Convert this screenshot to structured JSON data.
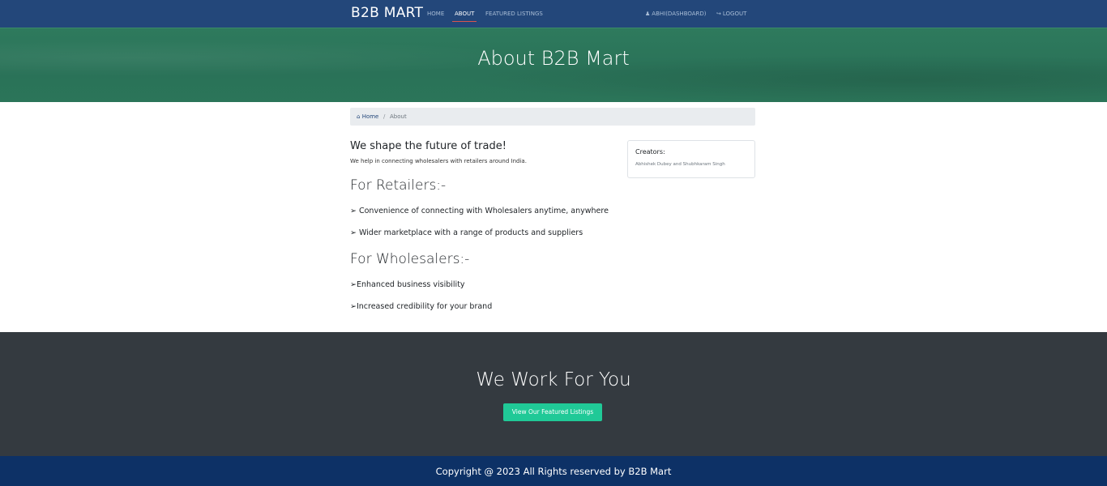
{
  "navbar": {
    "brand": "B2B MART",
    "links": [
      {
        "label": "HOME",
        "active": false
      },
      {
        "label": "ABOUT",
        "active": true
      },
      {
        "label": "FEATURED LISTINGS",
        "active": false
      }
    ],
    "user_label": "ABHI(DASHBOARD)",
    "user_icon": "user-plus-icon",
    "logout_label": "LOGOUT",
    "logout_icon": "sign-out-icon",
    "colors": {
      "background": "#23477a",
      "active_underline": "#d9534f"
    }
  },
  "hero": {
    "title": "About B2B Mart",
    "background_color": "#2b7559"
  },
  "breadcrumb": {
    "home_icon": "home-icon",
    "home_label": "Home",
    "separator": "/",
    "current": "About"
  },
  "about": {
    "tagline": "We shape the future of trade!",
    "subtitle": "We help in connecting wholesalers with retailers around India.",
    "retailers": {
      "heading": "For Retailers:-",
      "items": [
        "➢ Convenience of connecting with Wholesalers anytime, anywhere",
        "➢ Wider marketplace with a range of products and suppliers"
      ]
    },
    "wholesalers": {
      "heading": "For Wholesalers:-",
      "items": [
        "➢Enhanced business visibility",
        "➢Increased credibility for your brand"
      ]
    }
  },
  "creators": {
    "title": "Creators:",
    "names": "Abhishek Dubey and Shubhkaram Singh"
  },
  "work": {
    "title": "We Work For You",
    "button_label": "View Our Featured Listings",
    "background_color": "#343a40",
    "button_color": "#20c997"
  },
  "footer": {
    "text": "Copyright @ 2023 All Rights reserved by B2B Mart",
    "background_color": "#0d3166"
  }
}
